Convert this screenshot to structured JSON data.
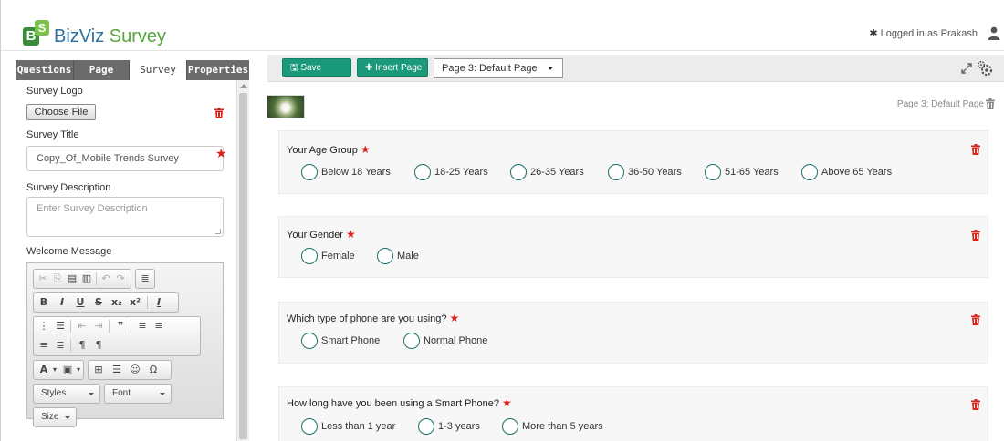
{
  "header": {
    "logo_letters": [
      "B",
      "S"
    ],
    "app_name_part1": "BizViz",
    "app_name_part2": " Survey",
    "login_text": "Logged in as Prakash",
    "login_marker": "✱"
  },
  "tabs": [
    "Questions",
    "Page",
    "Survey",
    "Properties"
  ],
  "survey_panel": {
    "logo_label": "Survey Logo",
    "choose_file": "Choose File",
    "title_label": "Survey Title",
    "title_value": "Copy_Of_Mobile Trends Survey",
    "description_label": "Survey Description",
    "description_placeholder": "Enter Survey Description",
    "welcome_label": "Welcome Message"
  },
  "editor": {
    "styles": "Styles",
    "font": "Font",
    "size": "Size"
  },
  "toolbar": {
    "save": "Save",
    "insert_page": "Insert Page",
    "page_select": "Page 3:  Default Page"
  },
  "page": {
    "label": "Page 3: Default Page"
  },
  "questions": [
    {
      "title": "Your Age Group",
      "required": "★",
      "options": [
        "Below 18 Years",
        "18-25 Years",
        "26-35 Years",
        "36-50 Years",
        "51-65 Years",
        "Above 65 Years"
      ]
    },
    {
      "title": "Your Gender",
      "required": "★",
      "options": [
        "Female",
        "Male"
      ]
    },
    {
      "title": "Which type of phone are you using?",
      "required": "★",
      "options": [
        "Smart Phone",
        "Normal Phone"
      ]
    },
    {
      "title": "How long have you been using a Smart Phone?",
      "required": "★",
      "options": [
        "Less than 1 year",
        "1-3 years",
        "More than 5 years"
      ]
    }
  ],
  "colors": {
    "brand_green": "#1a9a7a",
    "required_red": "#d9241c",
    "tab_dark": "#6b6b6b"
  }
}
